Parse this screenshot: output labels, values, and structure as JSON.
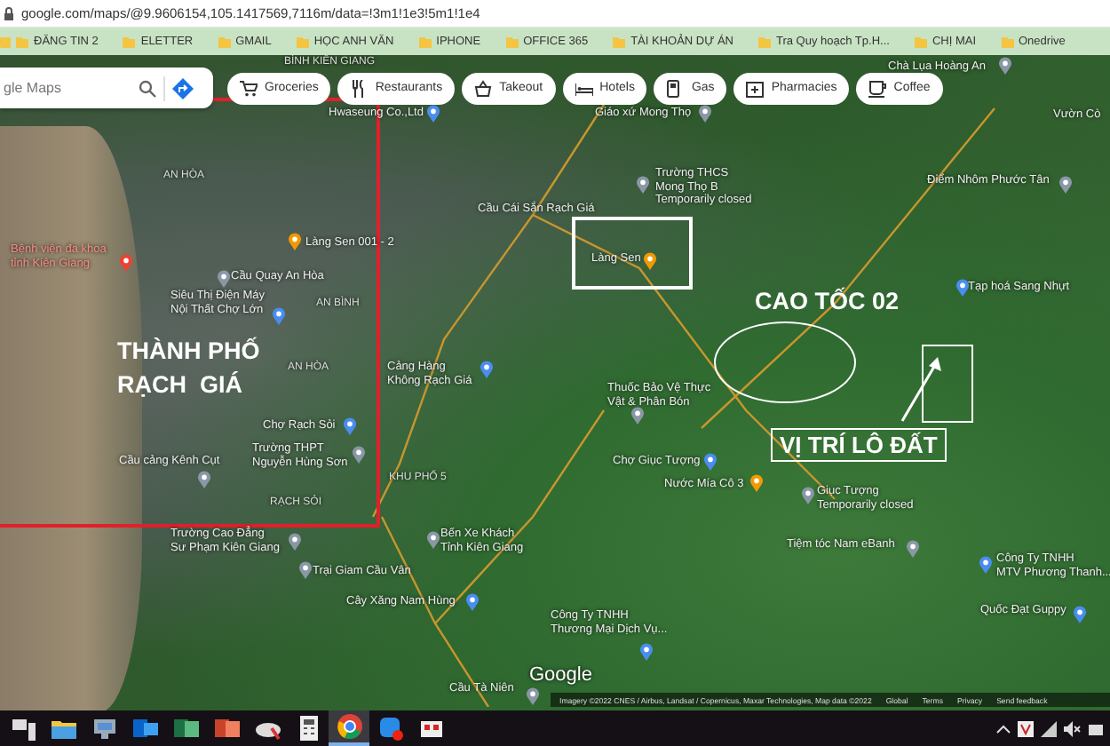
{
  "browser": {
    "url": "google.com/maps/@9.9606154,105.1417569,7116m/data=!3m1!1e3!5m1!1e4",
    "bookmarks": [
      "ĐĂNG TIN 2",
      "ELETTER",
      "GMAIL",
      "HỌC ANH VĂN",
      "IPHONE",
      "OFFICE 365",
      "TÀI KHOẢN DỰ ÁN",
      "Tra Quy hoạch Tp.H...",
      "CHỊ MAI",
      "Onedrive"
    ]
  },
  "search": {
    "placeholder": "gle Maps"
  },
  "chips": [
    {
      "label": "Groceries",
      "kind": "cart"
    },
    {
      "label": "Restaurants",
      "kind": "fork"
    },
    {
      "label": "Takeout",
      "kind": "bag"
    },
    {
      "label": "Hotels",
      "kind": "bed"
    },
    {
      "label": "Gas",
      "kind": "fuel"
    },
    {
      "label": "Pharmacies",
      "kind": "pharmacy"
    },
    {
      "label": "Coffee",
      "kind": "cup"
    }
  ],
  "map_labels": [
    {
      "lines": [
        "BÌNH KIÊN GIANG"
      ],
      "kind": "area"
    },
    {
      "lines": [
        "Chà Lụa Hoàng An"
      ],
      "kind": "landmark"
    },
    {
      "lines": [
        "Hwaseung Co.,Ltd"
      ],
      "kind": "shop"
    },
    {
      "lines": [
        "AN HÒA"
      ],
      "kind": "area"
    },
    {
      "lines": [
        "Giáo xứ Mong Thọ"
      ],
      "kind": "landmark"
    },
    {
      "lines": [
        "Vườn Cò"
      ],
      "kind": "plain"
    },
    {
      "lines": [
        "Trường THCS",
        "Mong Thọ B",
        "Temporarily closed"
      ],
      "kind": "landmark"
    },
    {
      "lines": [
        "Cầu Cái Sắn Rạch Giá"
      ],
      "kind": "landmark"
    },
    {
      "lines": [
        "Điểm Nhôm Phước Tân"
      ],
      "kind": "landmark"
    },
    {
      "lines": [
        "Làng Sen"
      ],
      "kind": "food"
    },
    {
      "lines": [
        "Làng Sen 001 - 2"
      ],
      "kind": "food"
    },
    {
      "lines": [
        "Cầu Quay An Hòa"
      ],
      "kind": "landmark"
    },
    {
      "lines": [
        "Bệnh viện đa khoa",
        "tỉnh Kiên Giang"
      ],
      "kind": "hospital"
    },
    {
      "lines": [
        "Siêu Thị Điện Máy",
        "Nội Thất Chợ Lớn"
      ],
      "kind": "shop"
    },
    {
      "lines": [
        "AN BÌNH"
      ],
      "kind": "area"
    },
    {
      "lines": [
        "Tạp hoá Sang Nhựt"
      ],
      "kind": "shop"
    },
    {
      "lines": [
        "AN HÒA"
      ],
      "kind": "area"
    },
    {
      "lines": [
        "Cảng Hàng",
        "Không Rạch Giá"
      ],
      "kind": "airport"
    },
    {
      "lines": [
        "Thuốc Bảo Vệ Thực",
        "Vật & Phân Bón"
      ],
      "kind": "landmark"
    },
    {
      "lines": [
        "Chợ Rạch Sỏi"
      ],
      "kind": "shop"
    },
    {
      "lines": [
        "Cầu cảng Kênh Cụt"
      ],
      "kind": "landmark"
    },
    {
      "lines": [
        "Trường THPT",
        "Nguyễn Hùng Sơn"
      ],
      "kind": "landmark"
    },
    {
      "lines": [
        "KHU PHỐ 5"
      ],
      "kind": "area"
    },
    {
      "lines": [
        "RẠCH SỎI"
      ],
      "kind": "area"
    },
    {
      "lines": [
        "Chợ Giục Tượng"
      ],
      "kind": "shop"
    },
    {
      "lines": [
        "Nước Mía Cô 3"
      ],
      "kind": "food"
    },
    {
      "lines": [
        "Giục Tượng",
        "Temporarily closed"
      ],
      "kind": "landmark"
    },
    {
      "lines": [
        "Trường Cao Đẳng",
        "Sư Phạm Kiên Giang"
      ],
      "kind": "landmark"
    },
    {
      "lines": [
        "Bến Xe Khách",
        "Tỉnh Kiên Giang"
      ],
      "kind": "landmark"
    },
    {
      "lines": [
        "Trại Giam Cầu Vân"
      ],
      "kind": "landmark"
    },
    {
      "lines": [
        "Tiệm tóc Nam eBanh"
      ],
      "kind": "landmark"
    },
    {
      "lines": [
        "Công Ty TNHH",
        "MTV Phương Thanh..."
      ],
      "kind": "shop"
    },
    {
      "lines": [
        "Cây Xăng Nam Hùng"
      ],
      "kind": "shop"
    },
    {
      "lines": [
        "Quốc Đạt Guppy"
      ],
      "kind": "shop"
    },
    {
      "lines": [
        "Công Ty TNHH",
        "Thương Mại Dịch Vụ..."
      ],
      "kind": "shop"
    },
    {
      "lines": [
        "Cầu Tà Niên"
      ],
      "kind": "landmark"
    }
  ],
  "annotations": {
    "city": [
      "THÀNH PHỐ",
      "RẠCH  GIÁ"
    ],
    "highway": "CAO TỐC 02",
    "plot": "VỊ TRÍ LÔ ĐẤT"
  },
  "logo": "Google",
  "attribution": {
    "text": "Imagery ©2022 CNES / Airbus, Landsat / Copernicus, Maxar Technologies, Map data ©2022",
    "links": [
      "Global",
      "Terms",
      "Privacy",
      "Send feedback"
    ]
  },
  "taskbar": [
    {
      "kind": "computer",
      "selected": false
    },
    {
      "kind": "folder",
      "selected": false
    },
    {
      "kind": "monitor",
      "selected": false
    },
    {
      "kind": "mail",
      "selected": false
    },
    {
      "kind": "sheet",
      "selected": false
    },
    {
      "kind": "slides",
      "selected": false
    },
    {
      "kind": "cloud",
      "selected": false
    },
    {
      "kind": "calculator",
      "selected": false
    },
    {
      "kind": "browser",
      "selected": true
    },
    {
      "kind": "chat",
      "selected": false
    },
    {
      "kind": "app",
      "selected": false
    }
  ]
}
